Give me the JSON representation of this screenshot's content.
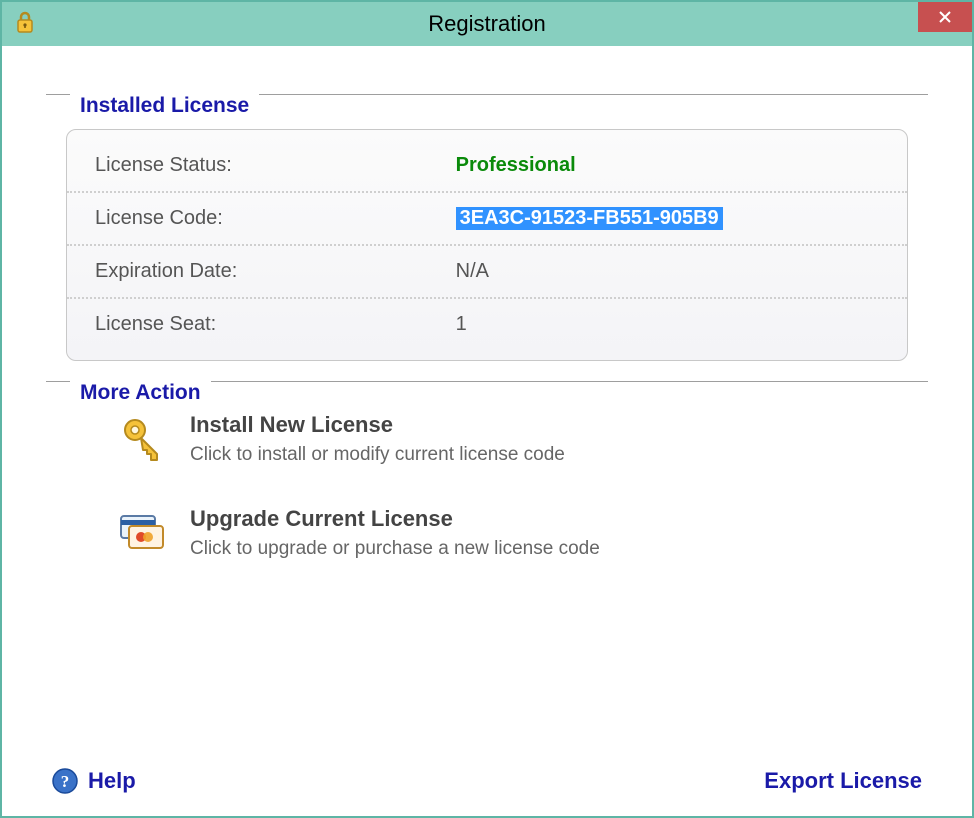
{
  "window": {
    "title": "Registration"
  },
  "groups": {
    "installed_license": "Installed License",
    "more_action": "More Action"
  },
  "license": {
    "status_label": "License Status:",
    "status_value": "Professional",
    "code_label": "License Code:",
    "code_value": "3EA3C-91523-FB551-905B9",
    "expiration_label": "Expiration Date:",
    "expiration_value": "N/A",
    "seat_label": "License Seat:",
    "seat_value": "1"
  },
  "actions": {
    "install": {
      "title": "Install New License",
      "desc": "Click to install or modify current license code"
    },
    "upgrade": {
      "title": "Upgrade Current License",
      "desc": "Click to upgrade or purchase a new license code"
    }
  },
  "footer": {
    "help": "Help",
    "export": "Export License"
  }
}
